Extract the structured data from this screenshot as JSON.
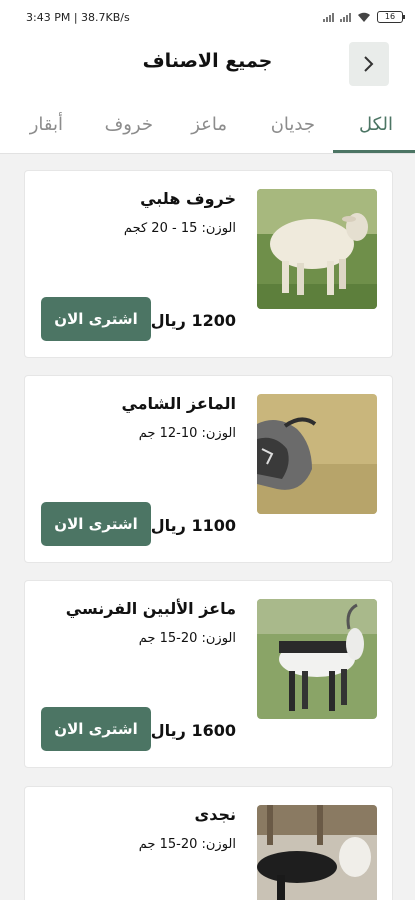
{
  "status_bar": {
    "time": "3:43 PM",
    "net_speed": "38.7KB/s",
    "battery": "16"
  },
  "header": {
    "title": "جميع الاصناف"
  },
  "tabs": [
    {
      "label": "الكل",
      "active": true
    },
    {
      "label": "جديان",
      "active": false
    },
    {
      "label": "ماعز",
      "active": false
    },
    {
      "label": "خروف",
      "active": false
    },
    {
      "label": "أبقار",
      "active": false
    }
  ],
  "products": [
    {
      "name": "خروف هلبي",
      "weight": "الوزن: 15 - 20 كجم",
      "price": "1200 ريال",
      "buy_label": "اشترى الان",
      "image": "sheep"
    },
    {
      "name": "الماعز الشامي",
      "weight": "الوزن: 10-12 جم",
      "price": "1100 ريال",
      "buy_label": "اشترى الان",
      "image": "shami-goat"
    },
    {
      "name": "ماعز الألبين الفرنسي",
      "weight": "الوزن: 20-15 جم",
      "price": "1600 ريال",
      "buy_label": "اشترى الان",
      "image": "alpine-goat"
    },
    {
      "name": "نجدى",
      "weight": "الوزن: 20-15 جم",
      "price": "",
      "buy_label": "",
      "image": "najdi-sheep"
    }
  ],
  "colors": {
    "accent": "#4c7564",
    "back_button_bg": "#e9ecea"
  }
}
